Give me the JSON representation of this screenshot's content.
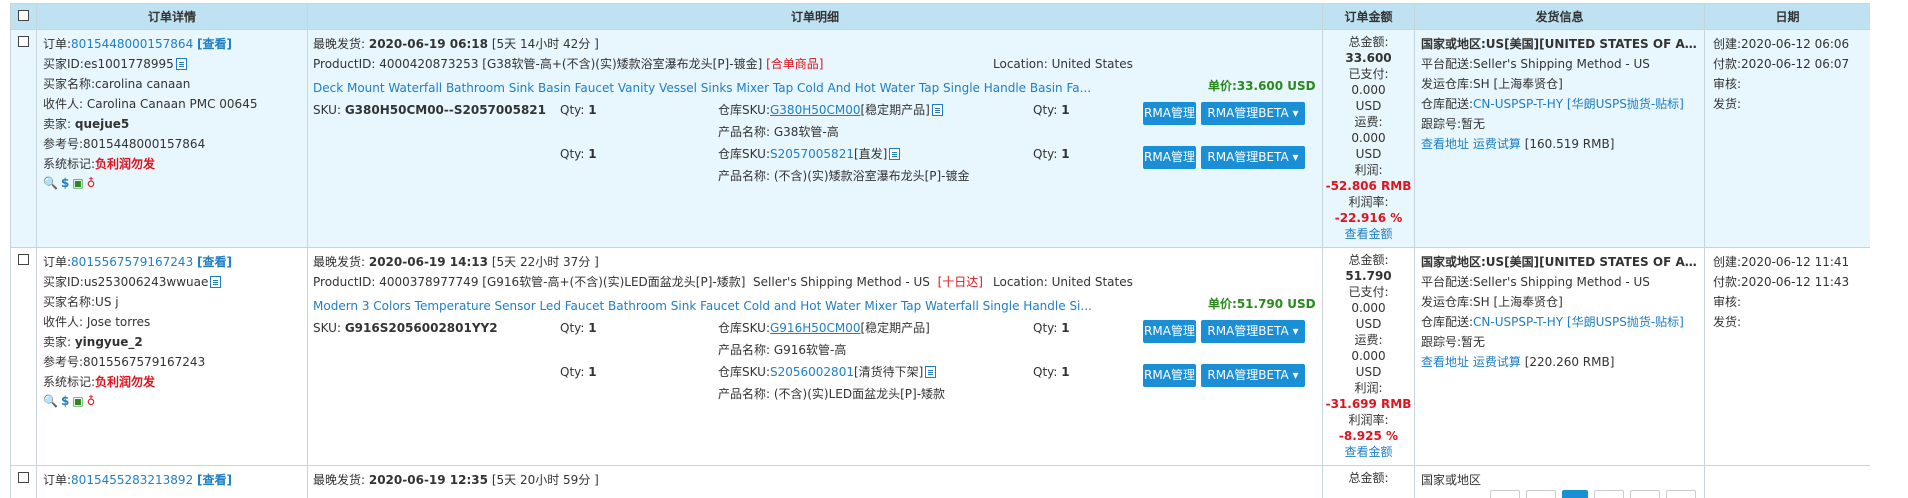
{
  "headers": {
    "details": "订单详情",
    "items": "订单明细",
    "amount": "订单金额",
    "shipping": "发货信息",
    "date": "日期"
  },
  "orders": [
    {
      "order_label": "订单:",
      "order_no": "8015448000157864",
      "view": "[查看]",
      "buyer_id_label": "买家ID:",
      "buyer_id": "es1001778995",
      "buyer_name": "买家名称:carolina canaan",
      "recipient": "收件人: Carolina Canaan PMC 00645",
      "seller_label": "卖家: ",
      "seller": "quejue5",
      "ref": "参考号:8015448000157864",
      "flag_label": "系统标记:",
      "flag": "负利润勿发",
      "latest_ship_label": "最晚发货: ",
      "latest_ship": "2020-06-19 06:18",
      "latest_remain": "[5天 14小时 42分 ]",
      "product_id": "ProductID: 4000420873253",
      "product_desc": "[G38软管-高+(不含)(实)矮款浴室瀑布龙头[P]-镀金]",
      "tag": "[合单商品]",
      "shipping_method": "",
      "location": "Location: United States",
      "title": "Deck Mount Waterfall Bathroom Sink Basin Faucet Vanity Vessel Sinks Mixer Tap Cold And Hot Water Tap Single Handle Basin Fa...",
      "unit_price_label": "单价:",
      "unit_price": "33.600 USD",
      "sku": "G380H50CM00--S2057005821",
      "qty_label": "Qty: ",
      "qty1": "1",
      "qty2": "1",
      "wh1_label": "仓库SKU:",
      "wh1_sku": "G380H50CM00",
      "wh1_status": "[稳定期产品]",
      "pn1": "产品名称: G38软管-高",
      "wh2_label": "仓库SKU:",
      "wh2_sku": "S2057005821",
      "wh2_status": "[直发]",
      "pn2": "产品名称: (不含)(实)矮款浴室瀑布龙头[P]-镀金",
      "rqty1": "1",
      "rqty2": "1",
      "rma": "RMA管理",
      "rma_beta": "RMA管理BETA ▾",
      "total_label": "总金额:",
      "total": "33.600",
      "paid_label": "已支付:",
      "paid": "0.000",
      "paid_cur": "USD",
      "freight_label": "运费:",
      "freight": "0.000",
      "freight_cur": "USD",
      "profit_label": "利润:",
      "profit": "-52.806 RMB",
      "margin_label": "利润率:",
      "margin": "-22.916 %",
      "view_amount": "查看金额",
      "country": "国家或地区:US[美国][UNITED STATES OF AME...",
      "platform": "平台配送:Seller's Shipping Method - US",
      "warehouse": "发运仓库:SH [上海奉贤仓]",
      "wh_ship_label": "仓库配送:",
      "wh_ship": "CN-USPSP-T-HY [华朗USPS抛货-贴标]",
      "tracking": "跟踪号:暂无",
      "view_addr": "查看地址",
      "trial": "运费试算",
      "trial_val": "[160.519 RMB]",
      "created": "创建:2020-06-12 06:06",
      "payment": "付款:2020-06-12 06:07",
      "audit": "审核:",
      "ship": "发货:"
    },
    {
      "order_label": "订单:",
      "order_no": "8015567579167243",
      "view": "[查看]",
      "buyer_id_label": "买家ID:",
      "buyer_id": "us253006243wwuae",
      "buyer_name": "买家名称:US j",
      "recipient": "收件人: Jose torres",
      "seller_label": "卖家: ",
      "seller": "yingyue_2",
      "ref": "参考号:8015567579167243",
      "flag_label": "系统标记:",
      "flag": "负利润勿发",
      "latest_ship_label": "最晚发货: ",
      "latest_ship": "2020-06-19 14:13",
      "latest_remain": "[5天 22小时 37分 ]",
      "product_id": "ProductID: 4000378977749",
      "product_desc": "[G916软管-高+(不含)(实)LED面盆龙头[P]-矮款]",
      "tag": "[十日达]",
      "shipping_method": "Seller's Shipping Method - US",
      "location": "Location: United States",
      "title": "Modern 3 Colors Temperature Sensor Led Faucet Bathroom Sink Faucet Cold and Hot Water Mixer Tap Waterfall Single Handle Si...",
      "unit_price_label": "单价:",
      "unit_price": "51.790 USD",
      "sku": "G916S2056002801YY2",
      "qty_label": "Qty: ",
      "qty1": "1",
      "qty2": "1",
      "wh1_label": "仓库SKU:",
      "wh1_sku": "G916H50CM00",
      "wh1_status": "[稳定期产品]",
      "pn1": "产品名称: G916软管-高",
      "wh2_label": "仓库SKU:",
      "wh2_sku": "S2056002801",
      "wh2_status": "[清货待下架]",
      "pn2": "产品名称: (不含)(实)LED面盆龙头[P]-矮款",
      "rqty1": "1",
      "rqty2": "1",
      "rma": "RMA管理",
      "rma_beta": "RMA管理BETA ▾",
      "total_label": "总金额:",
      "total": "51.790",
      "paid_label": "已支付:",
      "paid": "0.000",
      "paid_cur": "USD",
      "freight_label": "运费:",
      "freight": "0.000",
      "freight_cur": "USD",
      "profit_label": "利润:",
      "profit": "-31.699 RMB",
      "margin_label": "利润率:",
      "margin": "-8.925 %",
      "view_amount": "查看金额",
      "country": "国家或地区:US[美国][UNITED STATES OF AME...",
      "platform": "平台配送:Seller's Shipping Method - US",
      "warehouse": "发运仓库:SH [上海奉贤仓]",
      "wh_ship_label": "仓库配送:",
      "wh_ship": "CN-USPSP-T-HY [华朗USPS抛货-贴标]",
      "tracking": "跟踪号:暂无",
      "view_addr": "查看地址",
      "trial": "运费试算",
      "trial_val": "[220.260 RMB]",
      "created": "创建:2020-06-12 11:41",
      "payment": "付款:2020-06-12 11:43",
      "audit": "审核:",
      "ship": "发货:"
    }
  ],
  "partial": {
    "order_label": "订单:",
    "order_no": "8015455283213892",
    "view": "[查看]",
    "latest_ship_label": "最晚发货: ",
    "latest_ship": "2020-06-19 12:35",
    "latest_remain": "[5天 20小时 59分 ]",
    "total_label": "总金额:",
    "country": "国家或地区"
  }
}
